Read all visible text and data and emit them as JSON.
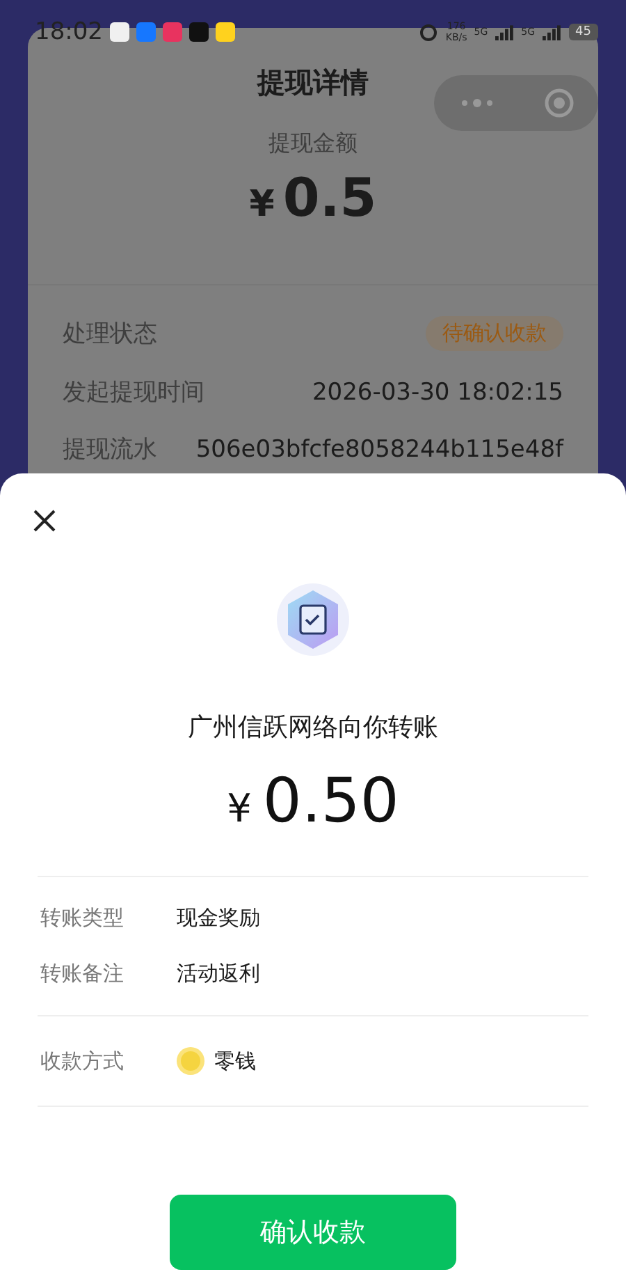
{
  "status_bar": {
    "time": "18:02",
    "speed": "176",
    "speed_unit": "KB/s",
    "signals": [
      "5G",
      "5G"
    ],
    "battery": "45"
  },
  "background_page": {
    "title": "提现详情",
    "amount_label": "提现金额",
    "currency": "¥",
    "amount": "0.5",
    "rows": [
      {
        "kind": "badge",
        "label": "处理状态",
        "value": "待确认收款"
      },
      {
        "kind": "text",
        "label": "发起提现时间",
        "value": "2026-03-30 18:02:15"
      },
      {
        "kind": "text",
        "label": "提现流水",
        "value": "506e03bfcfe8058244b115e48f"
      }
    ]
  },
  "sheet": {
    "title": "广州信跃网络向你转账",
    "currency": "¥",
    "amount": "0.50",
    "details": [
      {
        "label": "转账类型",
        "value": "现金奖励"
      },
      {
        "label": "转账备注",
        "value": "活动返利"
      }
    ],
    "payment": {
      "label": "收款方式",
      "value": "零钱"
    },
    "button": "确认收款"
  }
}
